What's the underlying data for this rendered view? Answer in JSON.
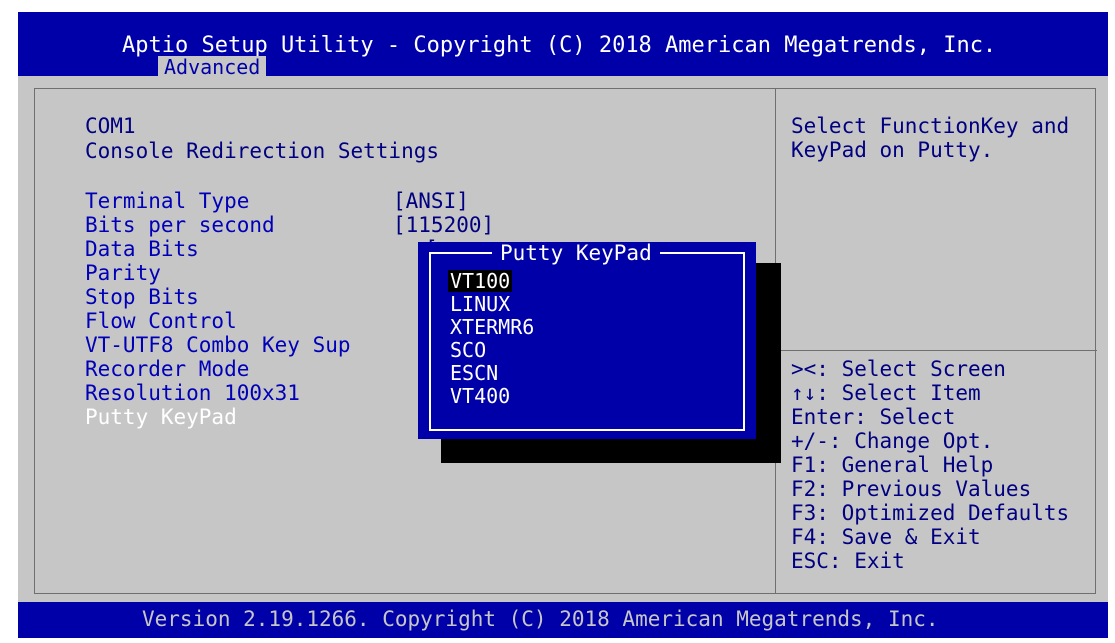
{
  "header": {
    "title": "Aptio Setup Utility - Copyright (C) 2018 American Megatrends, Inc.",
    "active_tab": "Advanced"
  },
  "main": {
    "section_line1": "COM1",
    "section_line2": "Console Redirection Settings",
    "settings": [
      {
        "label": "Terminal Type",
        "value": "[ANSI]"
      },
      {
        "label": "Bits per second",
        "value": "[115200]"
      },
      {
        "label": "Data Bits",
        "value": "["
      },
      {
        "label": "Parity",
        "value": "["
      },
      {
        "label": "Stop Bits",
        "value": "["
      },
      {
        "label": "Flow Control",
        "value": "["
      },
      {
        "label": "VT-UTF8 Combo Key Sup",
        "value": "["
      },
      {
        "label": "Recorder Mode",
        "value": "["
      },
      {
        "label": "Resolution 100x31",
        "value": "["
      },
      {
        "label": "Putty KeyPad",
        "value": "["
      }
    ]
  },
  "popup": {
    "title": "Putty KeyPad",
    "options": [
      "VT100",
      "LINUX",
      "XTERMR6",
      "SCO",
      "ESCN",
      "VT400"
    ],
    "selected": "VT100"
  },
  "help": {
    "line1": "Select FunctionKey and",
    "line2": "KeyPad on Putty."
  },
  "keys": [
    "><: Select Screen",
    "↑↓: Select Item",
    "Enter: Select",
    "+/-: Change Opt.",
    "F1: General Help",
    "F2: Previous Values",
    "F3: Optimized Defaults",
    "F4: Save & Exit",
    "ESC: Exit"
  ],
  "footer": {
    "version": "Version 2.19.1266. Copyright (C) 2018 American Megatrends, Inc."
  },
  "colors": {
    "bios_blue": "#0000a8",
    "bios_gray": "#c6c6c6",
    "highlight_white": "#ffffff",
    "text_dark_blue": "#000080"
  }
}
